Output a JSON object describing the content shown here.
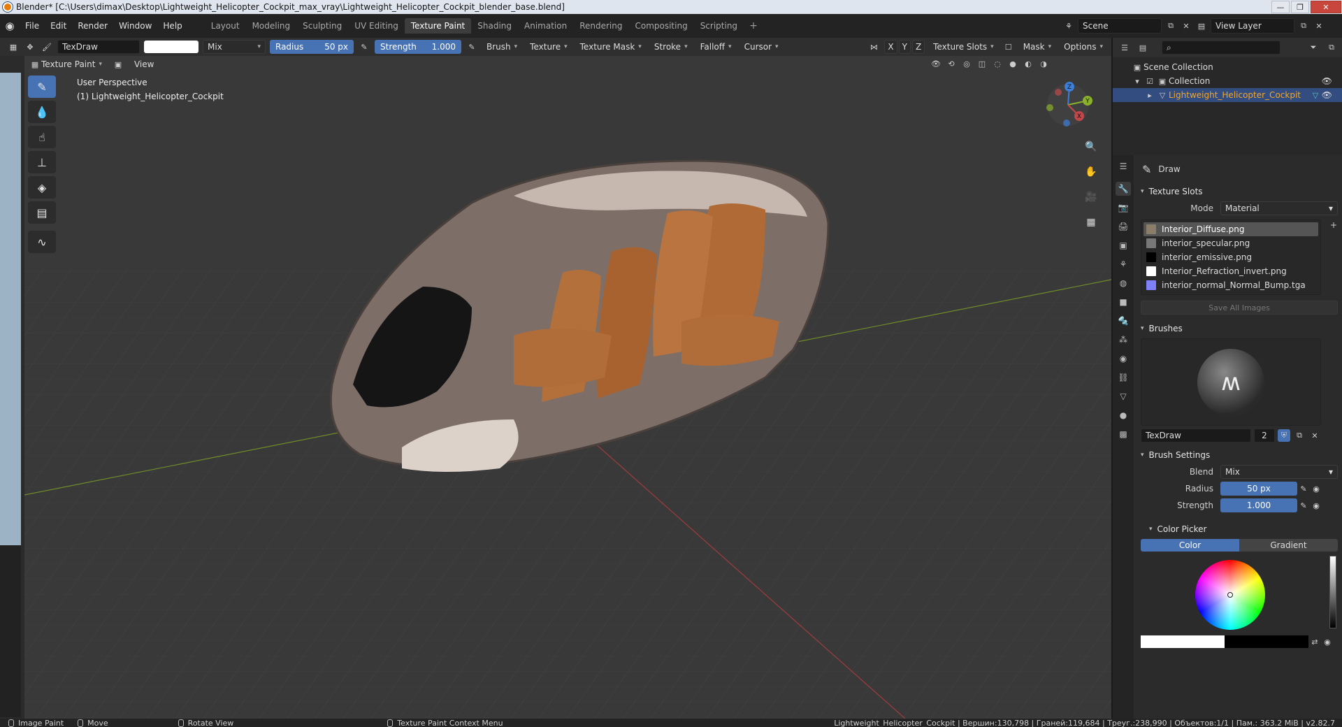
{
  "window": {
    "title": "Blender* [C:\\Users\\dimax\\Desktop\\Lightweight_Helicopter_Cockpit_max_vray\\Lightweight_Helicopter_Cockpit_blender_base.blend]"
  },
  "menubar": {
    "items": [
      "File",
      "Edit",
      "Render",
      "Window",
      "Help"
    ],
    "workspaces": [
      "Layout",
      "Modeling",
      "Sculpting",
      "UV Editing",
      "Texture Paint",
      "Shading",
      "Animation",
      "Rendering",
      "Compositing",
      "Scripting"
    ],
    "active_workspace": "Texture Paint",
    "scene": "Scene",
    "view_layer": "View Layer"
  },
  "toolheader": {
    "brush_name": "TexDraw",
    "blend": "Mix",
    "radius_label": "Radius",
    "radius_value": "50 px",
    "strength_label": "Strength",
    "strength_value": "1.000",
    "menus": [
      "Brush",
      "Texture",
      "Texture Mask",
      "Stroke",
      "Falloff",
      "Cursor"
    ],
    "axes": [
      "X",
      "Y",
      "Z"
    ],
    "right_menus": [
      "Texture Slots",
      "Mask",
      "Options"
    ]
  },
  "subheader": {
    "mode": "Texture Paint",
    "view": "View"
  },
  "viewport": {
    "perspective": "User Perspective",
    "object": "(1) Lightweight_Helicopter_Cockpit",
    "gizmo_labels": [
      "Z",
      "Y",
      "X"
    ]
  },
  "outliner": {
    "scene_collection": "Scene Collection",
    "collection": "Collection",
    "object": "Lightweight_Helicopter_Cockpit"
  },
  "properties": {
    "tool_name": "Draw",
    "texture_slots_title": "Texture Slots",
    "mode_label": "Mode",
    "mode_value": "Material",
    "slots": [
      {
        "name": "Interior_Diffuse.png",
        "color": "#8a7d6a"
      },
      {
        "name": "interior_specular.png",
        "color": "#777777"
      },
      {
        "name": "interior_emissive.png",
        "color": "#000000"
      },
      {
        "name": "Interior_Refraction_invert.png",
        "color": "#ffffff"
      },
      {
        "name": "interior_normal_Normal_Bump.tga",
        "color": "#8080ff"
      }
    ],
    "save_all": "Save All Images",
    "brushes_title": "Brushes",
    "brush_name": "TexDraw",
    "brush_users": "2",
    "brush_settings_title": "Brush Settings",
    "blend_label": "Blend",
    "blend_value": "Mix",
    "radius_label": "Radius",
    "radius_value": "50 px",
    "strength_label": "Strength",
    "strength_value": "1.000",
    "color_picker_title": "Color Picker",
    "color_tab": "Color",
    "gradient_tab": "Gradient"
  },
  "statusbar": {
    "left": [
      {
        "label": "Image Paint"
      },
      {
        "label": "Move"
      },
      {
        "label": "Rotate View"
      },
      {
        "label": "Texture Paint Context Menu"
      }
    ],
    "stats": "Lightweight_Helicopter_Cockpit | Вершин:130,798 | Граней:119,684 | Треуг.:238,990 | Объектов:1/1 | Пам.: 363.2 MiB | v2.82.7"
  },
  "colors": {
    "accent": "#4772b3",
    "selected_row": "#334d80",
    "object_orange": "#f5a623",
    "x_axis": "#c0474a",
    "y_axis": "#8ab12a",
    "z_axis": "#3d7ed9"
  }
}
